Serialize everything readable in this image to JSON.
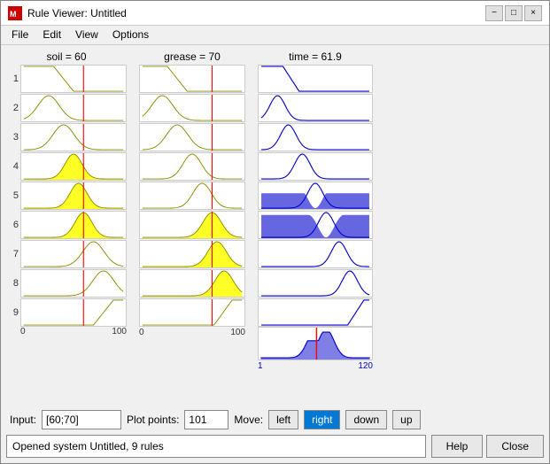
{
  "window": {
    "title": "Rule Viewer: Untitled",
    "icon": "matlab-icon"
  },
  "titlebar": {
    "minimize": "−",
    "maximize": "□",
    "close": "×"
  },
  "menu": {
    "items": [
      "File",
      "Edit",
      "View",
      "Options"
    ]
  },
  "columns": {
    "soil": {
      "header": "soil = 60",
      "axis_min": "0",
      "axis_max": "100",
      "red_line_pct": 0.6
    },
    "grease": {
      "header": "grease = 70",
      "axis_min": "0",
      "axis_max": "100",
      "red_line_pct": 0.7
    },
    "time": {
      "header": "time = 61.9",
      "axis_min": "1",
      "axis_max": "120"
    }
  },
  "rules": {
    "count": 9,
    "labels": [
      "1",
      "2",
      "3",
      "4",
      "5",
      "6",
      "7",
      "8",
      "9"
    ]
  },
  "controls": {
    "input_label": "Input:",
    "input_value": "[60;70]",
    "plot_points_label": "Plot points:",
    "plot_points_value": "101",
    "move_label": "Move:",
    "move_buttons": [
      "left",
      "right",
      "down",
      "up"
    ]
  },
  "status": {
    "text": "Opened system Untitled, 9 rules"
  },
  "action_buttons": {
    "help": "Help",
    "close": "Close"
  }
}
